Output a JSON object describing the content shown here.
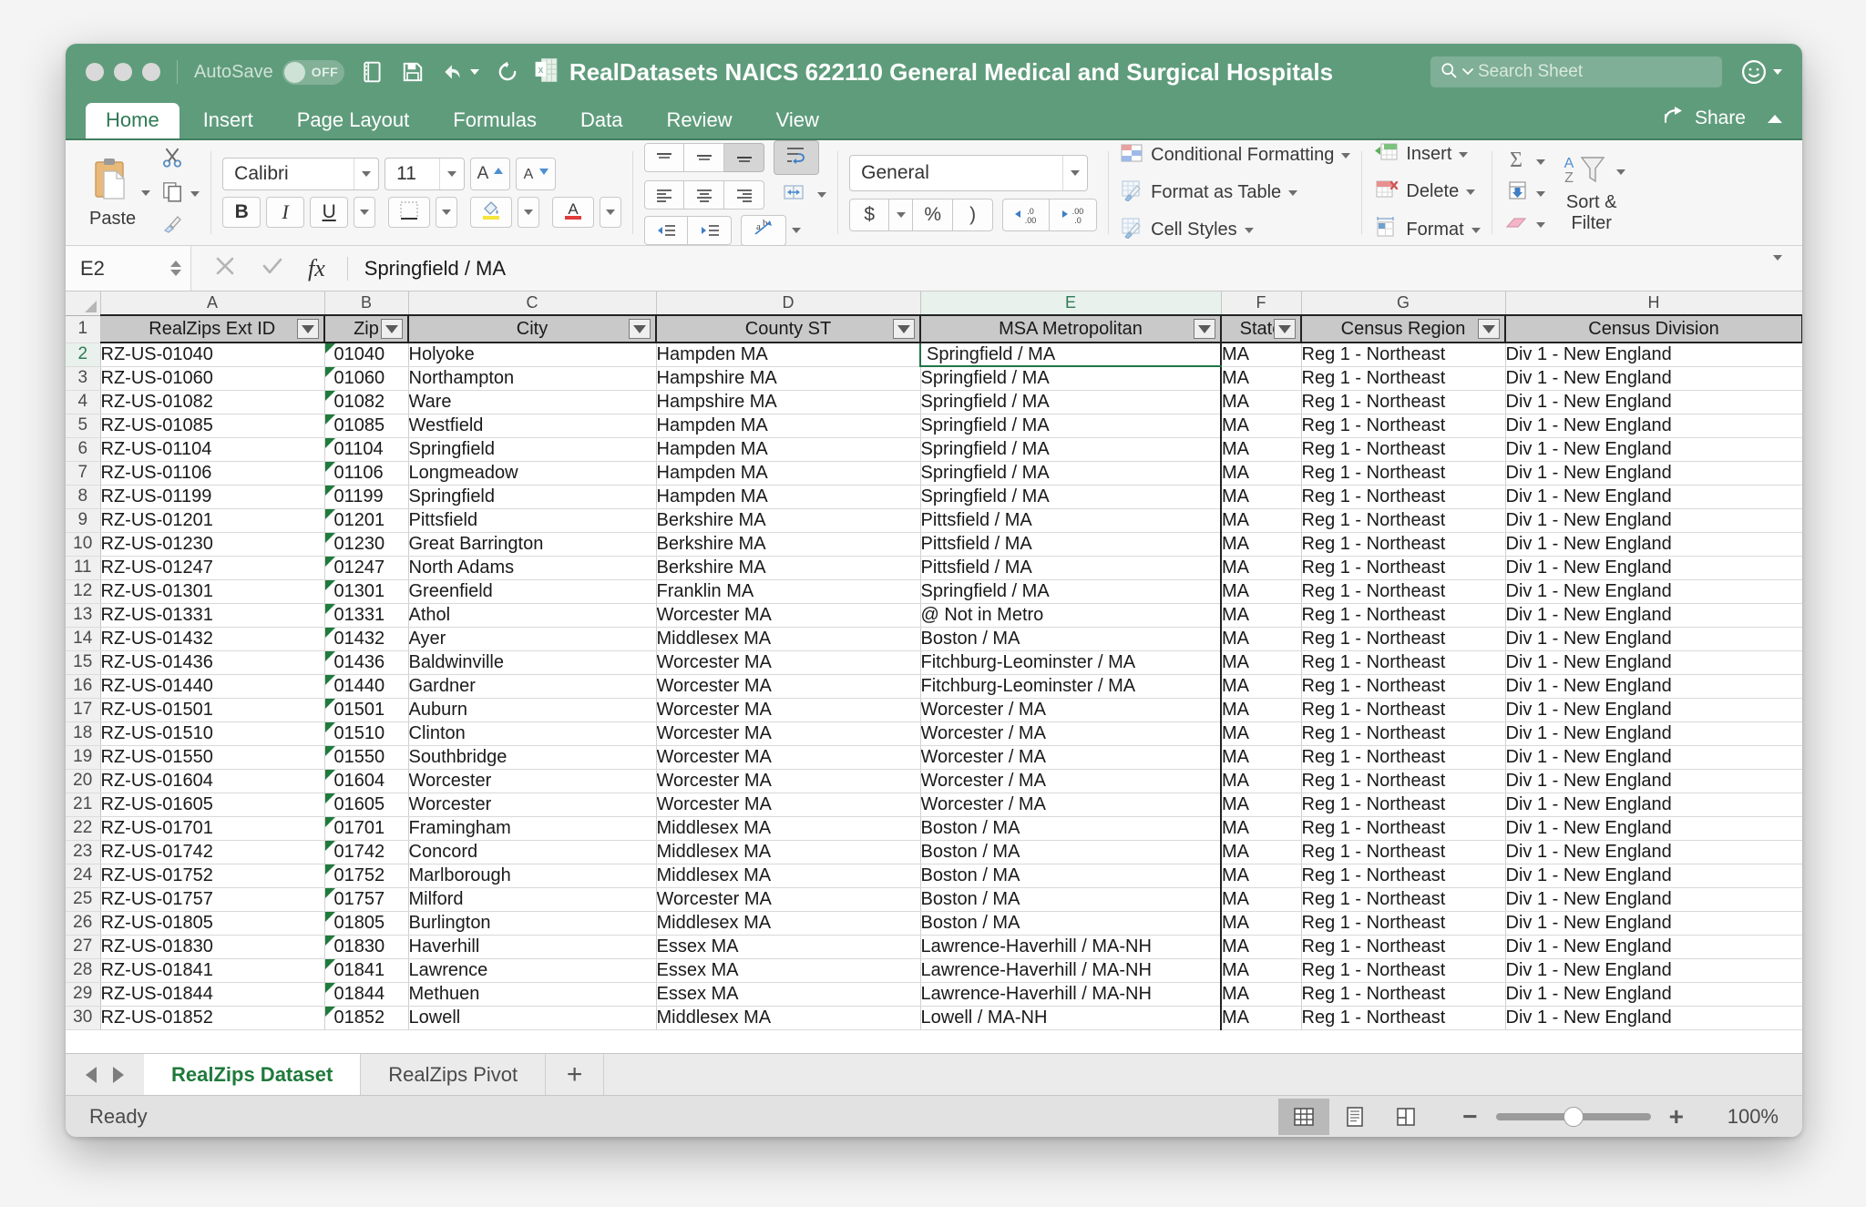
{
  "window": {
    "title": "RealDatasets NAICS 622110 General Medical and Surgical Hospitals",
    "autosave_label": "AutoSave",
    "autosave_state": "OFF",
    "search_placeholder": "Search Sheet",
    "share_label": "Share"
  },
  "ribbon_tabs": [
    {
      "label": "Home",
      "active": true
    },
    {
      "label": "Insert",
      "active": false
    },
    {
      "label": "Page Layout",
      "active": false
    },
    {
      "label": "Formulas",
      "active": false
    },
    {
      "label": "Data",
      "active": false
    },
    {
      "label": "Review",
      "active": false
    },
    {
      "label": "View",
      "active": false
    }
  ],
  "ribbon": {
    "clipboard": {
      "paste_label": "Paste"
    },
    "font": {
      "family": "Calibri",
      "size": "11"
    },
    "number": {
      "format": "General"
    },
    "styles": {
      "conditional_formatting": "Conditional Formatting",
      "format_as_table": "Format as Table",
      "cell_styles": "Cell Styles"
    },
    "cells": {
      "insert": "Insert",
      "delete": "Delete",
      "format": "Format"
    },
    "editing": {
      "sort_filter_line1": "Sort &",
      "sort_filter_line2": "Filter"
    }
  },
  "formula_bar": {
    "name_box": "E2",
    "value": "Springfield / MA"
  },
  "grid": {
    "column_letters": [
      "A",
      "B",
      "C",
      "D",
      "E",
      "F",
      "G",
      "H"
    ],
    "selected_column": "E",
    "selected_row": 2,
    "active_cell": "E2",
    "headers": [
      "RealZips Ext ID",
      "Zip",
      "City",
      "County ST",
      "MSA Metropolitan",
      "State",
      "Census Region",
      "Census Division"
    ],
    "header_row_number": 1,
    "rows": [
      {
        "n": 2,
        "cells": [
          "RZ-US-01040",
          "01040",
          "Holyoke",
          "Hampden MA",
          "Springfield / MA",
          "MA",
          "Reg 1 - Northeast",
          "Div 1 - New England"
        ]
      },
      {
        "n": 3,
        "cells": [
          "RZ-US-01060",
          "01060",
          "Northampton",
          "Hampshire MA",
          "Springfield / MA",
          "MA",
          "Reg 1 - Northeast",
          "Div 1 - New England"
        ]
      },
      {
        "n": 4,
        "cells": [
          "RZ-US-01082",
          "01082",
          "Ware",
          "Hampshire MA",
          "Springfield / MA",
          "MA",
          "Reg 1 - Northeast",
          "Div 1 - New England"
        ]
      },
      {
        "n": 5,
        "cells": [
          "RZ-US-01085",
          "01085",
          "Westfield",
          "Hampden MA",
          "Springfield / MA",
          "MA",
          "Reg 1 - Northeast",
          "Div 1 - New England"
        ]
      },
      {
        "n": 6,
        "cells": [
          "RZ-US-01104",
          "01104",
          "Springfield",
          "Hampden MA",
          "Springfield / MA",
          "MA",
          "Reg 1 - Northeast",
          "Div 1 - New England"
        ]
      },
      {
        "n": 7,
        "cells": [
          "RZ-US-01106",
          "01106",
          "Longmeadow",
          "Hampden MA",
          "Springfield / MA",
          "MA",
          "Reg 1 - Northeast",
          "Div 1 - New England"
        ]
      },
      {
        "n": 8,
        "cells": [
          "RZ-US-01199",
          "01199",
          "Springfield",
          "Hampden MA",
          "Springfield / MA",
          "MA",
          "Reg 1 - Northeast",
          "Div 1 - New England"
        ]
      },
      {
        "n": 9,
        "cells": [
          "RZ-US-01201",
          "01201",
          "Pittsfield",
          "Berkshire MA",
          "Pittsfield / MA",
          "MA",
          "Reg 1 - Northeast",
          "Div 1 - New England"
        ]
      },
      {
        "n": 10,
        "cells": [
          "RZ-US-01230",
          "01230",
          "Great Barrington",
          "Berkshire MA",
          "Pittsfield / MA",
          "MA",
          "Reg 1 - Northeast",
          "Div 1 - New England"
        ]
      },
      {
        "n": 11,
        "cells": [
          "RZ-US-01247",
          "01247",
          "North Adams",
          "Berkshire MA",
          "Pittsfield / MA",
          "MA",
          "Reg 1 - Northeast",
          "Div 1 - New England"
        ]
      },
      {
        "n": 12,
        "cells": [
          "RZ-US-01301",
          "01301",
          "Greenfield",
          "Franklin MA",
          "Springfield / MA",
          "MA",
          "Reg 1 - Northeast",
          "Div 1 - New England"
        ]
      },
      {
        "n": 13,
        "cells": [
          "RZ-US-01331",
          "01331",
          "Athol",
          "Worcester MA",
          "@ Not in Metro",
          "MA",
          "Reg 1 - Northeast",
          "Div 1 - New England"
        ]
      },
      {
        "n": 14,
        "cells": [
          "RZ-US-01432",
          "01432",
          "Ayer",
          "Middlesex MA",
          "Boston / MA",
          "MA",
          "Reg 1 - Northeast",
          "Div 1 - New England"
        ]
      },
      {
        "n": 15,
        "cells": [
          "RZ-US-01436",
          "01436",
          "Baldwinville",
          "Worcester MA",
          "Fitchburg-Leominster / MA",
          "MA",
          "Reg 1 - Northeast",
          "Div 1 - New England"
        ]
      },
      {
        "n": 16,
        "cells": [
          "RZ-US-01440",
          "01440",
          "Gardner",
          "Worcester MA",
          "Fitchburg-Leominster / MA",
          "MA",
          "Reg 1 - Northeast",
          "Div 1 - New England"
        ]
      },
      {
        "n": 17,
        "cells": [
          "RZ-US-01501",
          "01501",
          "Auburn",
          "Worcester MA",
          "Worcester / MA",
          "MA",
          "Reg 1 - Northeast",
          "Div 1 - New England"
        ]
      },
      {
        "n": 18,
        "cells": [
          "RZ-US-01510",
          "01510",
          "Clinton",
          "Worcester MA",
          "Worcester / MA",
          "MA",
          "Reg 1 - Northeast",
          "Div 1 - New England"
        ]
      },
      {
        "n": 19,
        "cells": [
          "RZ-US-01550",
          "01550",
          "Southbridge",
          "Worcester MA",
          "Worcester / MA",
          "MA",
          "Reg 1 - Northeast",
          "Div 1 - New England"
        ]
      },
      {
        "n": 20,
        "cells": [
          "RZ-US-01604",
          "01604",
          "Worcester",
          "Worcester MA",
          "Worcester / MA",
          "MA",
          "Reg 1 - Northeast",
          "Div 1 - New England"
        ]
      },
      {
        "n": 21,
        "cells": [
          "RZ-US-01605",
          "01605",
          "Worcester",
          "Worcester MA",
          "Worcester / MA",
          "MA",
          "Reg 1 - Northeast",
          "Div 1 - New England"
        ]
      },
      {
        "n": 22,
        "cells": [
          "RZ-US-01701",
          "01701",
          "Framingham",
          "Middlesex MA",
          "Boston / MA",
          "MA",
          "Reg 1 - Northeast",
          "Div 1 - New England"
        ]
      },
      {
        "n": 23,
        "cells": [
          "RZ-US-01742",
          "01742",
          "Concord",
          "Middlesex MA",
          "Boston / MA",
          "MA",
          "Reg 1 - Northeast",
          "Div 1 - New England"
        ]
      },
      {
        "n": 24,
        "cells": [
          "RZ-US-01752",
          "01752",
          "Marlborough",
          "Middlesex MA",
          "Boston / MA",
          "MA",
          "Reg 1 - Northeast",
          "Div 1 - New England"
        ]
      },
      {
        "n": 25,
        "cells": [
          "RZ-US-01757",
          "01757",
          "Milford",
          "Worcester MA",
          "Boston / MA",
          "MA",
          "Reg 1 - Northeast",
          "Div 1 - New England"
        ]
      },
      {
        "n": 26,
        "cells": [
          "RZ-US-01805",
          "01805",
          "Burlington",
          "Middlesex MA",
          "Boston / MA",
          "MA",
          "Reg 1 - Northeast",
          "Div 1 - New England"
        ]
      },
      {
        "n": 27,
        "cells": [
          "RZ-US-01830",
          "01830",
          "Haverhill",
          "Essex MA",
          "Lawrence-Haverhill / MA-NH",
          "MA",
          "Reg 1 - Northeast",
          "Div 1 - New England"
        ]
      },
      {
        "n": 28,
        "cells": [
          "RZ-US-01841",
          "01841",
          "Lawrence",
          "Essex MA",
          "Lawrence-Haverhill / MA-NH",
          "MA",
          "Reg 1 - Northeast",
          "Div 1 - New England"
        ]
      },
      {
        "n": 29,
        "cells": [
          "RZ-US-01844",
          "01844",
          "Methuen",
          "Essex MA",
          "Lawrence-Haverhill / MA-NH",
          "MA",
          "Reg 1 - Northeast",
          "Div 1 - New England"
        ]
      },
      {
        "n": 30,
        "cells": [
          "RZ-US-01852",
          "01852",
          "Lowell",
          "Middlesex MA",
          "Lowell / MA-NH",
          "MA",
          "Reg 1 - Northeast",
          "Div 1 - New England"
        ]
      }
    ]
  },
  "sheet_tabs": [
    {
      "label": "RealZips Dataset",
      "active": true
    },
    {
      "label": "RealZips Pivot",
      "active": false
    }
  ],
  "add_sheet_label": "+",
  "status_bar": {
    "status": "Ready",
    "zoom": "100%",
    "zoom_out": "−",
    "zoom_in": "+"
  },
  "colors": {
    "titlebar_green": "#5f9c7c",
    "accent_green": "#217346",
    "tab_text_green": "#1f7a3c"
  }
}
